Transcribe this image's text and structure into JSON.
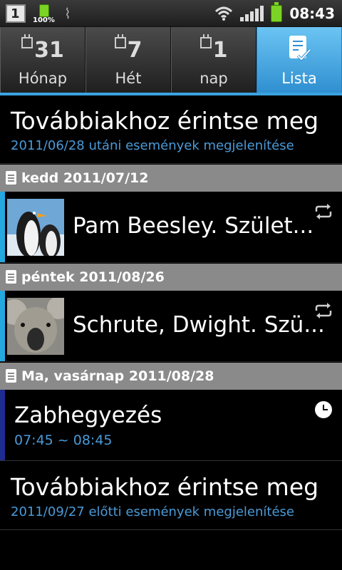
{
  "status_bar": {
    "battery_small_pct": "100%",
    "time": "08:43",
    "notification_digit": "1"
  },
  "tabs": [
    {
      "number": "31",
      "label": "Hónap",
      "icon": "calendar-icon"
    },
    {
      "number": "7",
      "label": "Hét",
      "icon": "calendar-icon"
    },
    {
      "number": "1",
      "label": "nap",
      "icon": "calendar-icon"
    },
    {
      "label": "Lista",
      "icon": "list-check-icon",
      "active": true
    }
  ],
  "list": {
    "more_top": {
      "title": "Továbbiakhoz érintse meg",
      "subtitle": "2011/06/28 utáni események megjelenítése"
    },
    "day1": {
      "header": "kedd 2011/07/12",
      "event": "Pam Beesley. Születésnap",
      "event_display": "Pam Beesley. Szület...",
      "color": "#25a7e0"
    },
    "day2": {
      "header": "péntek 2011/08/26",
      "event": "Schrute, Dwight. Születésnap",
      "event_display": "Schrute, Dwight. Szü...",
      "color": "#25a7e0"
    },
    "day3": {
      "header": "Ma, vasárnap 2011/08/28",
      "event": "Zabhegyezés",
      "time": "07:45 ~ 08:45",
      "color": "#1e2b8f"
    },
    "more_bottom": {
      "title": "Továbbiakhoz érintse meg",
      "subtitle": "2011/09/27 előtti események megjelenítése"
    }
  }
}
